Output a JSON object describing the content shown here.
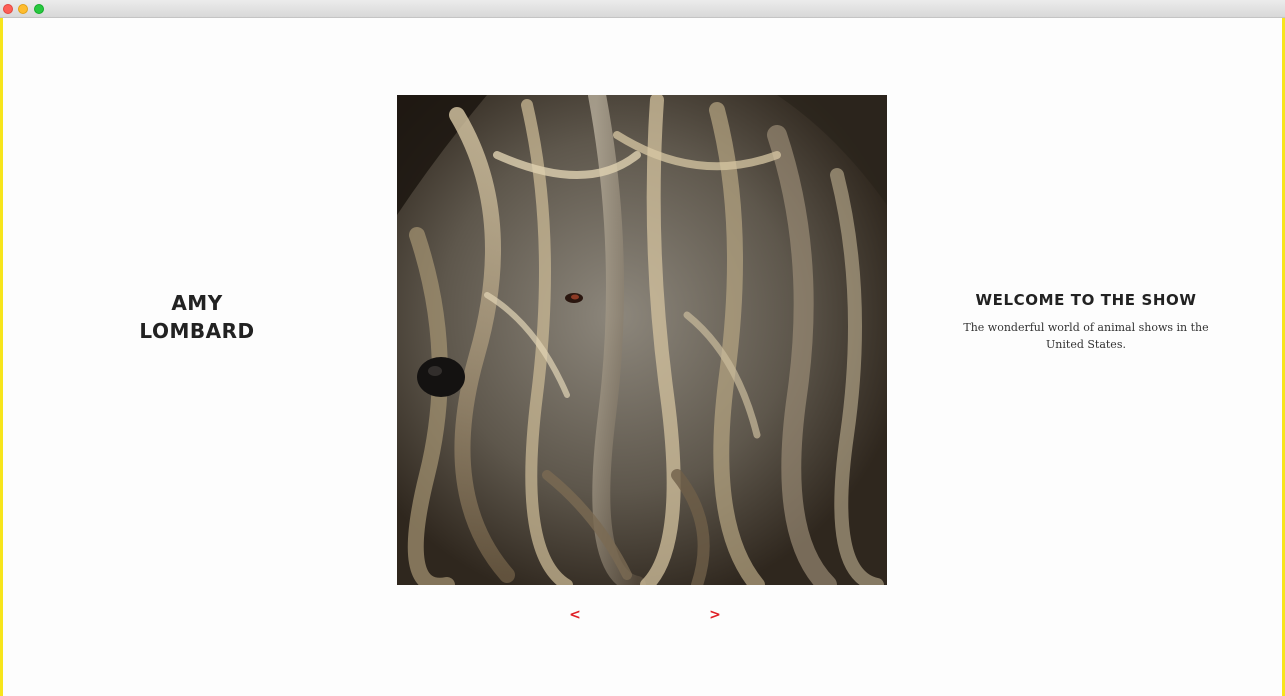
{
  "window": {
    "controls": [
      "close",
      "minimize",
      "zoom"
    ]
  },
  "artist": {
    "first_name": "AMY",
    "last_name": "LOMBARD"
  },
  "slideshow": {
    "image_subject": "long-haired corded dog portrait",
    "prev_label": "<",
    "next_label": ">"
  },
  "show": {
    "title": "WELCOME TO THE SHOW",
    "description": "The wonderful world of animal shows in the United States."
  },
  "colors": {
    "accent": "#e01f26",
    "frame": "#f7e51b",
    "text": "#222222"
  }
}
